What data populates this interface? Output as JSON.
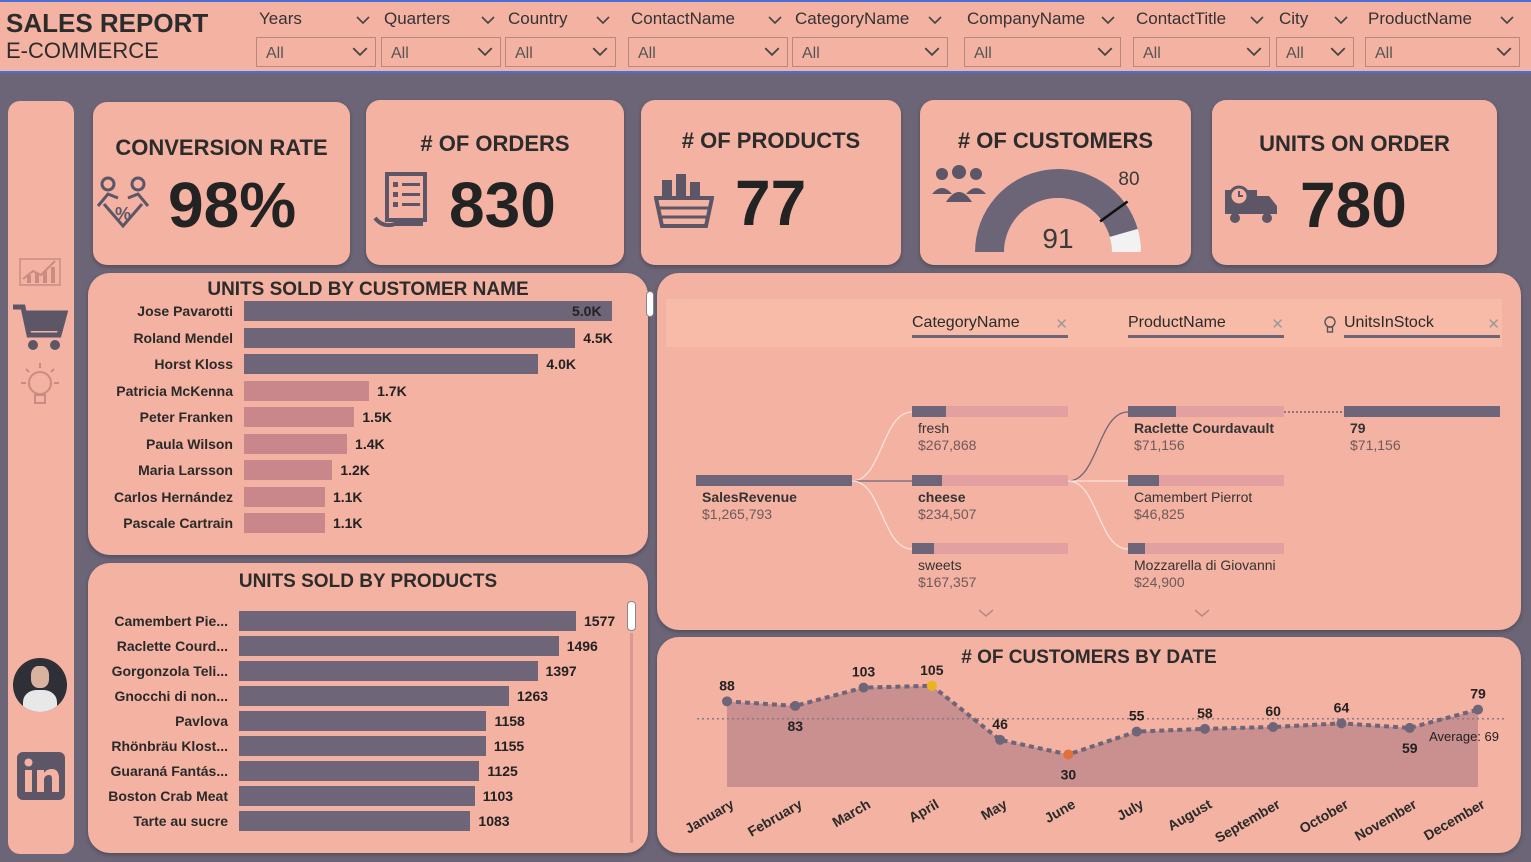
{
  "header": {
    "title": "SALES REPORT",
    "subtitle": "E-COMMERCE"
  },
  "slicers": [
    {
      "label": "Years",
      "value": "All"
    },
    {
      "label": "Quarters",
      "value": "All"
    },
    {
      "label": "Country",
      "value": "All"
    },
    {
      "label": "ContactName",
      "value": "All"
    },
    {
      "label": "CategoryName",
      "value": "All"
    },
    {
      "label": "CompanyName",
      "value": "All"
    },
    {
      "label": "ContactTitle",
      "value": "All"
    },
    {
      "label": "City",
      "value": "All"
    },
    {
      "label": "ProductName",
      "value": "All"
    }
  ],
  "kpis": {
    "conversion": {
      "title": "CONVERSION RATE",
      "value": "98%"
    },
    "orders": {
      "title": "# OF ORDERS",
      "value": "830"
    },
    "products": {
      "title": "# OF PRODUCTS",
      "value": "77"
    },
    "customers": {
      "title": "# OF CUSTOMERS",
      "value": "91",
      "target": "80",
      "max": 100
    },
    "units": {
      "title": "UNITS ON ORDER",
      "value": "780"
    }
  },
  "customers_chart": {
    "title": "UNITS SOLD BY CUSTOMER NAME",
    "max": 5000,
    "rows": [
      {
        "name": "Jose Pavarotti",
        "value": 5000,
        "label": "5.0K"
      },
      {
        "name": "Roland Mendel",
        "value": 4500,
        "label": "4.5K"
      },
      {
        "name": "Horst Kloss",
        "value": 4000,
        "label": "4.0K"
      },
      {
        "name": "Patricia McKenna",
        "value": 1700,
        "label": "1.7K"
      },
      {
        "name": "Peter Franken",
        "value": 1500,
        "label": "1.5K"
      },
      {
        "name": "Paula Wilson",
        "value": 1400,
        "label": "1.4K"
      },
      {
        "name": "Maria Larsson",
        "value": 1200,
        "label": "1.2K"
      },
      {
        "name": "Carlos Hernández",
        "value": 1100,
        "label": "1.1K"
      },
      {
        "name": "Pascale Cartrain",
        "value": 1100,
        "label": "1.1K"
      }
    ]
  },
  "products_chart": {
    "title": "UNITS SOLD BY PRODUCTS",
    "max": 1577,
    "rows": [
      {
        "name": "Camembert Pie...",
        "value": 1577
      },
      {
        "name": "Raclette Courd...",
        "value": 1496
      },
      {
        "name": "Gorgonzola Teli...",
        "value": 1397
      },
      {
        "name": "Gnocchi di non...",
        "value": 1263
      },
      {
        "name": "Pavlova",
        "value": 1158
      },
      {
        "name": "Rhönbräu Klost...",
        "value": 1155
      },
      {
        "name": "Guaraná Fantás...",
        "value": 1125
      },
      {
        "name": "Boston Crab Meat",
        "value": 1103
      },
      {
        "name": "Tarte au sucre",
        "value": 1083
      }
    ]
  },
  "tree": {
    "headers": [
      "CategoryName",
      "ProductName",
      "UnitsInStock"
    ],
    "root": {
      "name": "SalesRevenue",
      "value": "$1,265,793"
    },
    "categories": [
      {
        "name": "fresh",
        "value": "$267,868",
        "fill": 0.22
      },
      {
        "name": "cheese",
        "value": "$234,507",
        "fill": 0.19
      },
      {
        "name": "sweets",
        "value": "$167,357",
        "fill": 0.14
      }
    ],
    "products": [
      {
        "name": "Raclette Courdavault",
        "value": "$71,156",
        "fill": 0.31
      },
      {
        "name": "Camembert Pierrot",
        "value": "$46,825",
        "fill": 0.2
      },
      {
        "name": "Mozzarella di Giovanni",
        "value": "$24,900",
        "fill": 0.11
      }
    ],
    "stock": {
      "name": "79",
      "value": "$71,156"
    }
  },
  "chart_data": {
    "type": "area",
    "title": "# OF CUSTOMERS BY DATE",
    "categories": [
      "January",
      "February",
      "March",
      "April",
      "May",
      "June",
      "July",
      "August",
      "September",
      "October",
      "November",
      "December"
    ],
    "values": [
      88,
      83,
      103,
      105,
      46,
      30,
      55,
      58,
      60,
      64,
      59,
      79
    ],
    "average": 69,
    "average_label": "Average: 69",
    "highlight_max": "April",
    "highlight_min": "June",
    "colors": {
      "line": "#6f6579",
      "area": "#c9908f",
      "max": "#e8b51c",
      "min": "#e2703a"
    }
  }
}
